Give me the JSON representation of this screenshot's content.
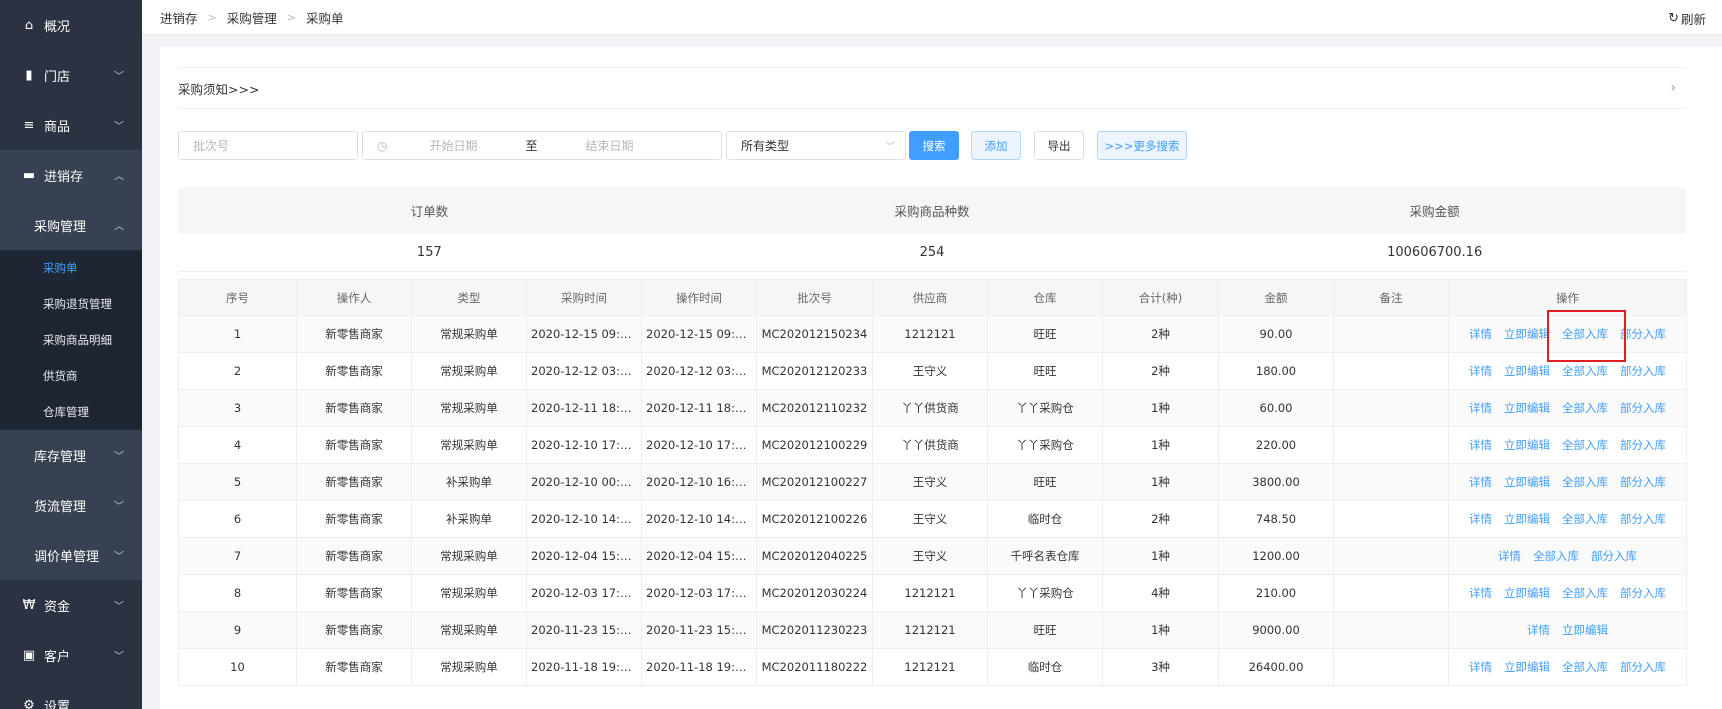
{
  "sidebar": {
    "overview": "概况",
    "store": "门店",
    "goods": "商品",
    "inventory": "进销存",
    "purchase_mgmt": "采购管理",
    "purchase_leaves": [
      "采购单",
      "采购退货管理",
      "采购商品明细",
      "供货商",
      "仓库管理"
    ],
    "stock_mgmt": "库存管理",
    "logistics_mgmt": "货流管理",
    "price_mgmt": "调价单管理",
    "funds": "资金",
    "customer": "客户",
    "settings": "设置"
  },
  "breadcrumb": [
    "进销存",
    "采购管理",
    "采购单"
  ],
  "refresh_label": "刷新",
  "notice": "采购须知>>>",
  "filters": {
    "batch_placeholder": "批次号",
    "start_date_placeholder": "开始日期",
    "range_sep": "至",
    "end_date_placeholder": "结束日期",
    "type_value": "所有类型",
    "search_btn": "搜索",
    "add_btn": "添加",
    "export_btn": "导出",
    "more_btn": ">>>更多搜索"
  },
  "stats": {
    "headers": [
      "订单数",
      "采购商品种数",
      "采购金额"
    ],
    "values": [
      "157",
      "254",
      "100606700.16"
    ]
  },
  "table": {
    "headers": [
      "序号",
      "操作人",
      "类型",
      "采购时间",
      "操作时间",
      "批次号",
      "供应商",
      "仓库",
      "合计(种)",
      "金额",
      "备注",
      "操作"
    ],
    "rows": [
      {
        "no": "1",
        "operator": "新零售商家",
        "type": "常规采购单",
        "ptime": "2020-12-15 09:4...",
        "otime": "2020-12-15 09:4...",
        "batch": "MC202012150234",
        "supplier": "1212121",
        "warehouse": "旺旺",
        "total": "2种",
        "amount": "90.00",
        "remark": "",
        "ops": [
          "详情",
          "立即编辑",
          "全部入库",
          "部分入库"
        ]
      },
      {
        "no": "2",
        "operator": "新零售商家",
        "type": "常规采购单",
        "ptime": "2020-12-12 03:3...",
        "otime": "2020-12-12 03:3...",
        "batch": "MC202012120233",
        "supplier": "王守义",
        "warehouse": "旺旺",
        "total": "2种",
        "amount": "180.00",
        "remark": "",
        "ops": [
          "详情",
          "立即编辑",
          "全部入库",
          "部分入库"
        ]
      },
      {
        "no": "3",
        "operator": "新零售商家",
        "type": "常规采购单",
        "ptime": "2020-12-11 18:22...",
        "otime": "2020-12-11 18:22...",
        "batch": "MC202012110232",
        "supplier": "丫丫供货商",
        "warehouse": "丫丫采购仓",
        "total": "1种",
        "amount": "60.00",
        "remark": "",
        "ops": [
          "详情",
          "立即编辑",
          "全部入库",
          "部分入库"
        ]
      },
      {
        "no": "4",
        "operator": "新零售商家",
        "type": "常规采购单",
        "ptime": "2020-12-10 17:3...",
        "otime": "2020-12-10 17:3...",
        "batch": "MC202012100229",
        "supplier": "丫丫供货商",
        "warehouse": "丫丫采购仓",
        "total": "1种",
        "amount": "220.00",
        "remark": "",
        "ops": [
          "详情",
          "立即编辑",
          "全部入库",
          "部分入库"
        ]
      },
      {
        "no": "5",
        "operator": "新零售商家",
        "type": "补采购单",
        "ptime": "2020-12-10 00:0...",
        "otime": "2020-12-10 16:5...",
        "batch": "MC202012100227",
        "supplier": "王守义",
        "warehouse": "旺旺",
        "total": "1种",
        "amount": "3800.00",
        "remark": "",
        "ops": [
          "详情",
          "立即编辑",
          "全部入库",
          "部分入库"
        ]
      },
      {
        "no": "6",
        "operator": "新零售商家",
        "type": "补采购单",
        "ptime": "2020-12-10 14:0...",
        "otime": "2020-12-10 14:0...",
        "batch": "MC202012100226",
        "supplier": "王守义",
        "warehouse": "临时仓",
        "total": "2种",
        "amount": "748.50",
        "remark": "",
        "ops": [
          "详情",
          "立即编辑",
          "全部入库",
          "部分入库"
        ]
      },
      {
        "no": "7",
        "operator": "新零售商家",
        "type": "常规采购单",
        "ptime": "2020-12-04 15:2...",
        "otime": "2020-12-04 15:2...",
        "batch": "MC202012040225",
        "supplier": "王守义",
        "warehouse": "千呼名表仓库",
        "total": "1种",
        "amount": "1200.00",
        "remark": "",
        "ops": [
          "详情",
          "全部入库",
          "部分入库"
        ]
      },
      {
        "no": "8",
        "operator": "新零售商家",
        "type": "常规采购单",
        "ptime": "2020-12-03 17:1...",
        "otime": "2020-12-03 17:1...",
        "batch": "MC202012030224",
        "supplier": "1212121",
        "warehouse": "丫丫采购仓",
        "total": "4种",
        "amount": "210.00",
        "remark": "",
        "ops": [
          "详情",
          "立即编辑",
          "全部入库",
          "部分入库"
        ]
      },
      {
        "no": "9",
        "operator": "新零售商家",
        "type": "常规采购单",
        "ptime": "2020-11-23 15:30...",
        "otime": "2020-11-23 15:30...",
        "batch": "MC202011230223",
        "supplier": "1212121",
        "warehouse": "旺旺",
        "total": "1种",
        "amount": "9000.00",
        "remark": "",
        "ops": [
          "详情",
          "立即编辑"
        ]
      },
      {
        "no": "10",
        "operator": "新零售商家",
        "type": "常规采购单",
        "ptime": "2020-11-18 19:37...",
        "otime": "2020-11-18 19:37...",
        "batch": "MC202011180222",
        "supplier": "1212121",
        "warehouse": "临时仓",
        "total": "3种",
        "amount": "26400.00",
        "remark": "",
        "ops": [
          "详情",
          "立即编辑",
          "全部入库",
          "部分入库"
        ]
      }
    ]
  },
  "colors": {
    "sidebar_bg": "#2b3342",
    "accent": "#409eff",
    "highlight": "#e02020"
  }
}
